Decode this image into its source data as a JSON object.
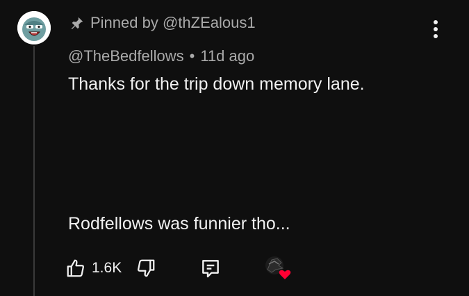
{
  "pinned": {
    "label": "Pinned by @thZEalous1"
  },
  "comment": {
    "author": "@TheBedfellows",
    "separator": "•",
    "timestamp": "11d ago",
    "line1": "Thanks for the trip down memory lane.",
    "line2": "Rodfellows was funnier tho..."
  },
  "actions": {
    "like_count": "1.6K"
  },
  "icons": {
    "pin": "pin-icon",
    "more": "more-vertical-icon",
    "like": "thumbs-up-icon",
    "dislike": "thumbs-down-icon",
    "reply": "reply-comment-icon",
    "heart": "creator-heart-icon"
  },
  "colors": {
    "background": "#0f0f0f",
    "text": "#f1f1f1",
    "secondary_text": "#aaaaaa",
    "heart": "#ff0033"
  }
}
